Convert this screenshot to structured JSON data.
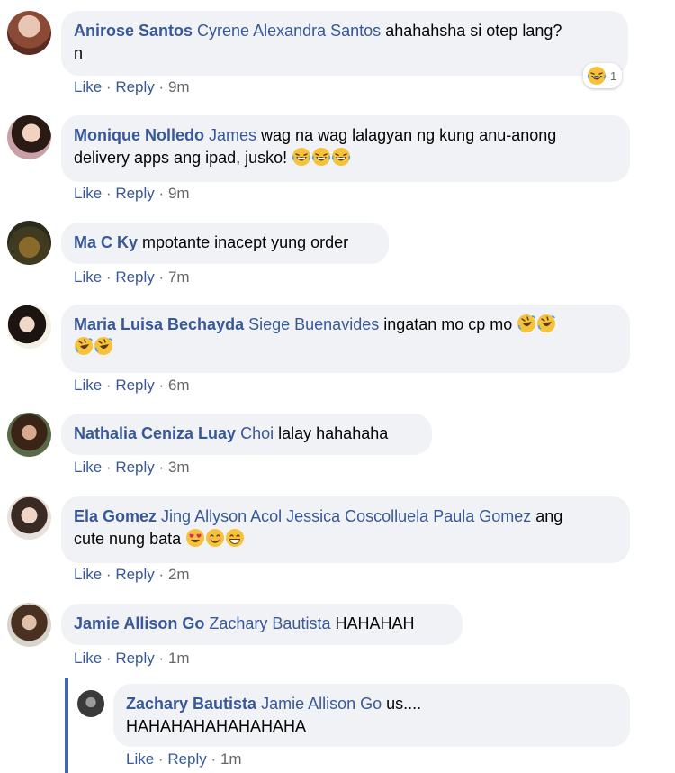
{
  "comments": [
    {
      "author": "Anirose Santos",
      "tag": "Cyrene Alexandra Santos",
      "text": "ahahahsha si otep lang?",
      "text2": "n",
      "like": "Like",
      "reply": "Reply",
      "time": "9m",
      "reaction_count": "1"
    },
    {
      "author": "Monique Nolledo",
      "tag": "James",
      "text": "wag na wag lalagyan ng kung anu-anong",
      "text2": "delivery apps ang ipad, jusko!",
      "like": "Like",
      "reply": "Reply",
      "time": "9m"
    },
    {
      "author": "Ma C Ky",
      "text": "mpotante inacept yung order",
      "like": "Like",
      "reply": "Reply",
      "time": "7m"
    },
    {
      "author": "Maria Luisa Bechayda",
      "tag": "Siege Buenavides",
      "text": "ingatan mo cp mo",
      "like": "Like",
      "reply": "Reply",
      "time": "6m"
    },
    {
      "author": "Nathalia Ceniza Luay",
      "tag": "Choi",
      "text": "lalay hahahaha",
      "like": "Like",
      "reply": "Reply",
      "time": "3m"
    },
    {
      "author": "Ela Gomez",
      "tag": "Jing Allyson Acol Jessica Coscolluela Paula Gomez",
      "text": "ang",
      "text2": "cute nung bata",
      "like": "Like",
      "reply": "Reply",
      "time": "2m"
    },
    {
      "author": "Jamie Allison Go",
      "tag": "Zachary Bautista",
      "text": "HAHAHAH",
      "like": "Like",
      "reply": "Reply",
      "time": "1m"
    }
  ],
  "reply": {
    "author": "Zachary Bautista",
    "tag": "Jamie Allison Go",
    "text": "us....",
    "text2": "HAHAHAHAHAHAHAHA",
    "like": "Like",
    "reply": "Reply",
    "time": "1m"
  },
  "colors": {
    "name_link": "#385898",
    "bubble_bg": "#f0f2f5",
    "meta_gray": "#65676b",
    "thread_line": "#4267b2"
  }
}
